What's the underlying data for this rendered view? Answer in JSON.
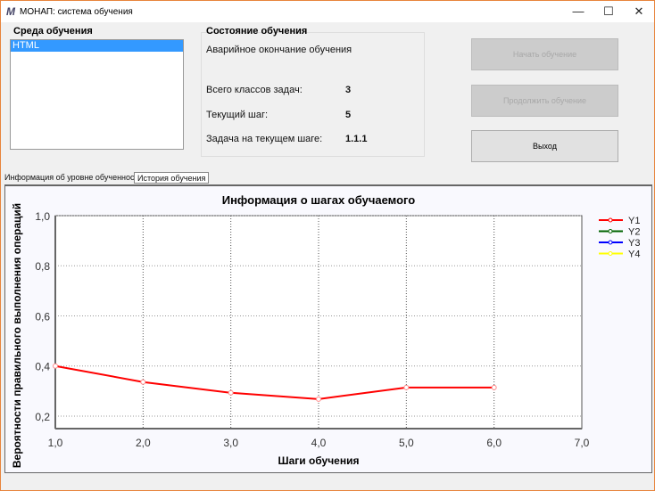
{
  "window": {
    "title": "МОНАП: система обучения",
    "icon": "app-logo-icon"
  },
  "env": {
    "title": "Среда обучения",
    "items": [
      "HTML"
    ]
  },
  "state": {
    "title": "Состояние обучения",
    "status": "Аварийное окончание обучения",
    "rows": [
      {
        "label": "Всего классов задач:",
        "value": "3"
      },
      {
        "label": "Текущий шаг:",
        "value": "5"
      },
      {
        "label": "Задача на текущем шаге:",
        "value": "1.1.1"
      }
    ]
  },
  "buttons": {
    "start": "Начать обучение",
    "continue": "Продолжить обучение",
    "exit": "Выход"
  },
  "tabs": [
    {
      "label": "Информация об уровне обученности"
    },
    {
      "label": "История обучения"
    }
  ],
  "chart_data": {
    "type": "line",
    "title": "Информация о шагах обучаемого",
    "xlabel": "Шаги обучения",
    "ylabel": "Вероятности правильного выполнения операций",
    "xlim": [
      1,
      7
    ],
    "ylim": [
      0.15,
      1.0
    ],
    "xticks": [
      "1,0",
      "2,0",
      "3,0",
      "4,0",
      "5,0",
      "6,0",
      "7,0"
    ],
    "yticks": [
      {
        "v": 0.2,
        "label": "0,2"
      },
      {
        "v": 0.4,
        "label": "0,4"
      },
      {
        "v": 0.6,
        "label": "0,6"
      },
      {
        "v": 0.8,
        "label": "0,8"
      },
      {
        "v": 1.0,
        "label": "1,0"
      }
    ],
    "grid": true,
    "legend_position": "right",
    "series": [
      {
        "name": "Y1",
        "color": "#ff0000",
        "x": [
          1,
          2,
          3,
          4,
          5,
          6
        ],
        "values": [
          0.4,
          0.336,
          0.293,
          0.268,
          0.314,
          0.314
        ]
      },
      {
        "name": "Y2",
        "color": "#006400",
        "x": [],
        "values": []
      },
      {
        "name": "Y3",
        "color": "#0000ff",
        "x": [],
        "values": []
      },
      {
        "name": "Y4",
        "color": "#ffff00",
        "x": [],
        "values": []
      }
    ]
  }
}
